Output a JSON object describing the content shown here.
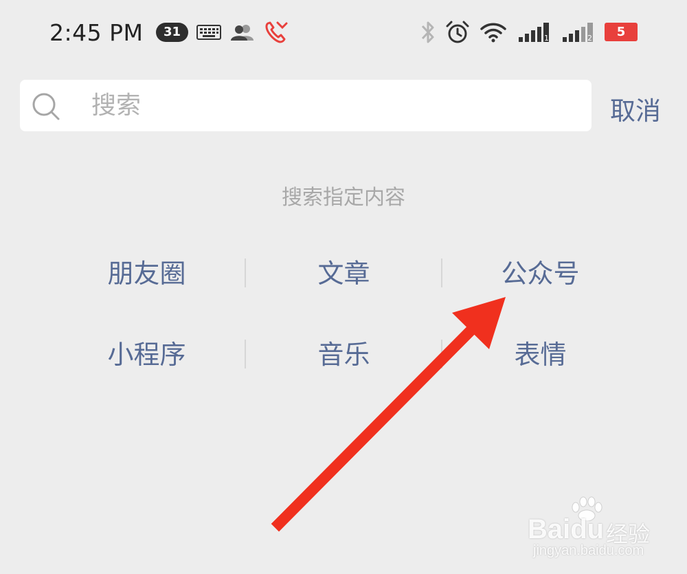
{
  "status_bar": {
    "time": "2:45 PM",
    "notification_badge": "31",
    "battery_level": "5",
    "icons": [
      "keyboard-icon",
      "contacts-icon",
      "missed-call-icon",
      "bluetooth-icon",
      "alarm-icon",
      "wifi-icon",
      "signal-sim1-icon",
      "signal-sim2-icon",
      "battery-icon"
    ],
    "colors": {
      "missed_call": "#e8403c",
      "battery_low": "#e8403c"
    }
  },
  "search": {
    "placeholder": "搜索",
    "value": "",
    "cancel_label": "取消"
  },
  "hint": "搜索指定内容",
  "categories": [
    [
      "朋友圈",
      "文章",
      "公众号"
    ],
    [
      "小程序",
      "音乐",
      "表情"
    ]
  ],
  "colors": {
    "background": "#ededed",
    "link_blue": "#576b95",
    "hint_gray": "#a8a8a8",
    "annotation_arrow": "#f0301e"
  },
  "watermark": {
    "brand": "Baidu",
    "cn": "经验",
    "url": "jingyan.baidu.com"
  }
}
